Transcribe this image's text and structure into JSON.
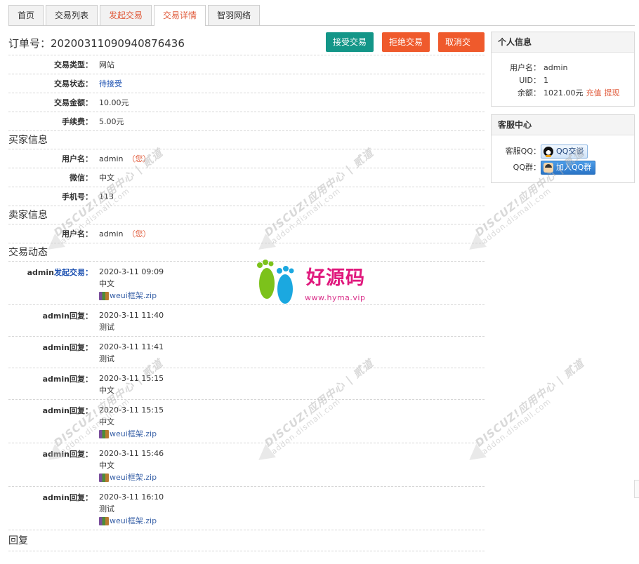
{
  "tabs": [
    "首页",
    "交易列表",
    "发起交易",
    "交易详情",
    "智羽网络"
  ],
  "order": {
    "title": "订单号：20200311090940876436",
    "buttons": {
      "accept": "接受交易",
      "reject": "拒绝交易",
      "cancel": "取消交易"
    }
  },
  "info": [
    {
      "label": "交易类型：",
      "value": "网站"
    },
    {
      "label": "交易状态：",
      "value": "待接受"
    },
    {
      "label": "交易金额：",
      "value": "10.00元"
    },
    {
      "label": "手续费：",
      "value": "5.00元"
    }
  ],
  "buyer": {
    "title": "买家信息",
    "rows": [
      {
        "label": "用户名：",
        "value": "admin",
        "note": "（您）"
      },
      {
        "label": "微信：",
        "value": "中文"
      },
      {
        "label": "手机号：",
        "value": "113"
      }
    ]
  },
  "seller": {
    "title": "卖家信息",
    "rows": [
      {
        "label": "用户名：",
        "value": "admin",
        "note": "（您）"
      }
    ]
  },
  "dynamics": {
    "title": "交易动态",
    "logs": [
      {
        "user": "admin",
        "action": "发起交易：",
        "time": "2020-3-11 09:09",
        "text": "中文",
        "file": "weui框架.zip"
      },
      {
        "user": "admin",
        "action": "回复：",
        "time": "2020-3-11 11:40",
        "text": "测试"
      },
      {
        "user": "admin",
        "action": "回复：",
        "time": "2020-3-11 11:41",
        "text": "测试"
      },
      {
        "user": "admin",
        "action": "回复：",
        "time": "2020-3-11 15:15",
        "text": "中文"
      },
      {
        "user": "admin",
        "action": "回复：",
        "time": "2020-3-11 15:15",
        "text": "中文",
        "file": "weui框架.zip"
      },
      {
        "user": "admin",
        "action": "回复：",
        "time": "2020-3-11 15:46",
        "text": "中文",
        "file": "weui框架.zip"
      },
      {
        "user": "admin",
        "action": "回复：",
        "time": "2020-3-11 16:10",
        "text": "测试",
        "file": "weui框架.zip"
      }
    ]
  },
  "reply": {
    "title": "回复"
  },
  "personal": {
    "title": "个人信息",
    "username_label": "用户名：",
    "username": "admin",
    "uid_label": "UID：",
    "uid": "1",
    "balance_label": "余额：",
    "balance": "1021.00元",
    "recharge": "充值",
    "withdraw": "提现"
  },
  "service": {
    "title": "客服中心",
    "qq_label": "客服QQ：",
    "qq_btn": "QQ交谈",
    "group_label": "QQ群：",
    "group_btn": "加入QQ群"
  },
  "logo": {
    "text": "好源码",
    "url": "www.hyma.vip"
  },
  "watermark": {
    "line1": "DISCUZ!应用中心 | 贰道",
    "line2": "addon.dismall.com"
  },
  "colors": {
    "accent": "#e05a3a",
    "accept": "#139688",
    "reject": "#ef5a2c",
    "link": "#1a4fb0"
  }
}
